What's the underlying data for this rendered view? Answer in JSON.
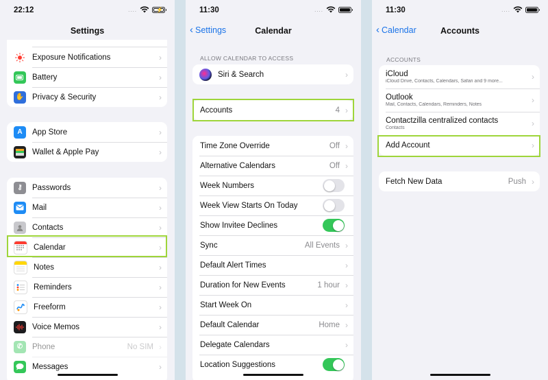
{
  "screen1": {
    "time": "22:12",
    "title": "Settings",
    "group1": [
      {
        "label": "Exposure Notifications",
        "icon": "exposure-icon",
        "color": "#ffffff"
      },
      {
        "label": "Battery",
        "icon": "battery-icon",
        "color": "#34c759"
      },
      {
        "label": "Privacy & Security",
        "icon": "hand-icon",
        "color": "#2f6fdc"
      }
    ],
    "group2": [
      {
        "label": "App Store",
        "icon": "app-store-icon",
        "color": "#1e8cf5"
      },
      {
        "label": "Wallet & Apple Pay",
        "icon": "wallet-icon",
        "color": "#222222"
      }
    ],
    "group3": [
      {
        "label": "Passwords",
        "icon": "key-icon",
        "color": "#8e8e93"
      },
      {
        "label": "Mail",
        "icon": "mail-icon",
        "color": "#1e8cf5"
      },
      {
        "label": "Contacts",
        "icon": "contacts-icon",
        "color": "#b0b0b0"
      },
      {
        "label": "Calendar",
        "icon": "calendar-icon",
        "color": "#ffffff"
      },
      {
        "label": "Notes",
        "icon": "notes-icon",
        "color": "#ffd60a"
      },
      {
        "label": "Reminders",
        "icon": "reminders-icon",
        "color": "#ffffff"
      },
      {
        "label": "Freeform",
        "icon": "freeform-icon",
        "color": "#ffffff"
      },
      {
        "label": "Voice Memos",
        "icon": "voice-memos-icon",
        "color": "#1c1c1e"
      },
      {
        "label": "Phone",
        "icon": "phone-icon",
        "color": "#34c759",
        "value": "No SIM"
      },
      {
        "label": "Messages",
        "icon": "messages-icon",
        "color": "#34c759"
      }
    ]
  },
  "screen2": {
    "time": "11:30",
    "back": "Settings",
    "title": "Calendar",
    "section_header": "ALLOW CALENDAR TO ACCESS",
    "siri": {
      "label": "Siri & Search",
      "icon": "siri-icon"
    },
    "accounts": {
      "label": "Accounts",
      "value": "4"
    },
    "rows": [
      {
        "label": "Time Zone Override",
        "value": "Off",
        "kind": "value"
      },
      {
        "label": "Alternative Calendars",
        "value": "Off",
        "kind": "value"
      },
      {
        "label": "Week Numbers",
        "kind": "toggle",
        "on": false
      },
      {
        "label": "Week View Starts On Today",
        "kind": "toggle",
        "on": false
      },
      {
        "label": "Show Invitee Declines",
        "kind": "toggle",
        "on": true
      },
      {
        "label": "Sync",
        "value": "All Events",
        "kind": "value"
      },
      {
        "label": "Default Alert Times",
        "value": "",
        "kind": "value"
      },
      {
        "label": "Duration for New Events",
        "value": "1 hour",
        "kind": "value"
      },
      {
        "label": "Start Week On",
        "value": "",
        "kind": "value"
      },
      {
        "label": "Default Calendar",
        "value": "Home",
        "kind": "value"
      },
      {
        "label": "Delegate Calendars",
        "value": "",
        "kind": "value"
      },
      {
        "label": "Location Suggestions",
        "kind": "toggle",
        "on": true
      }
    ]
  },
  "screen3": {
    "time": "11:30",
    "back": "Calendar",
    "title": "Accounts",
    "section_header": "ACCOUNTS",
    "accounts": [
      {
        "name": "iCloud",
        "detail": "iCloud Drive, Contacts, Calendars, Safari and 9 more..."
      },
      {
        "name": "Outlook",
        "detail": "Mail, Contacts, Calendars, Reminders, Notes"
      },
      {
        "name": "Contactzilla centralized contacts",
        "detail": "Contacts"
      }
    ],
    "add_account": "Add Account",
    "fetch": {
      "label": "Fetch New Data",
      "value": "Push"
    }
  },
  "colors": {
    "highlight": "#9ed53a",
    "link": "#1a73e8",
    "toggle_on": "#34c759",
    "background": "#f2f2f7"
  }
}
